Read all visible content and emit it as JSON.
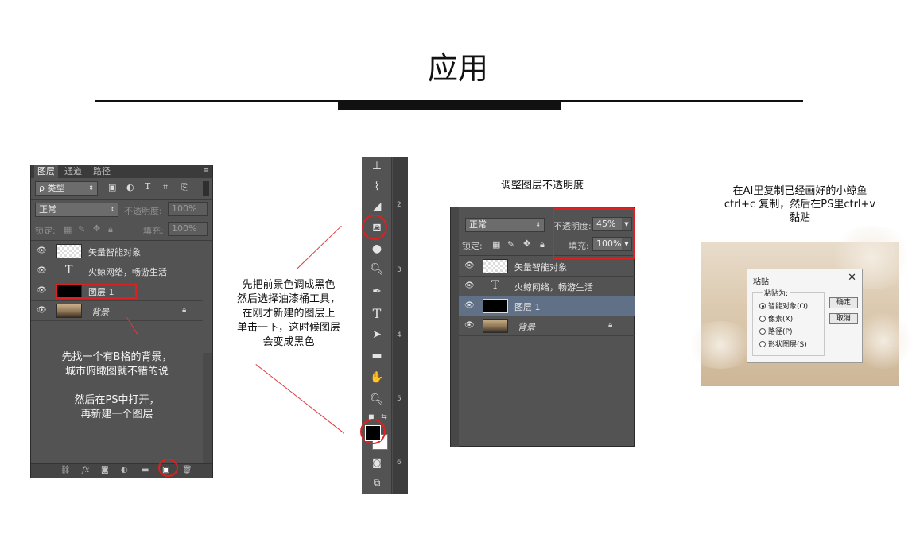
{
  "heading": {
    "title": "应用"
  },
  "left_panel": {
    "tabs": [
      "图层",
      "通道",
      "路径"
    ],
    "menu_icon": "≡",
    "filter_label": "ρ 类型",
    "filter_icons": [
      "image-filter-icon",
      "adjustment-filter-icon",
      "type-filter-icon",
      "shape-filter-icon",
      "smart-object-filter-icon"
    ],
    "blend_mode": "正常",
    "opacity_label": "不透明度:",
    "opacity_value": "100%",
    "lock_label": "锁定:",
    "fill_label": "填充:",
    "fill_value": "100%",
    "layers": [
      {
        "name": "矢量智能对象",
        "type": "smart-object"
      },
      {
        "name": "火鲸网络，畅游生活",
        "type": "text",
        "glyph": "T"
      },
      {
        "name": "图层 1",
        "type": "black-fill"
      },
      {
        "name": "背景",
        "type": "background"
      }
    ],
    "note_lines": [
      "先找一个有B格的背景，",
      "城市俯瞰图就不错的说",
      "",
      "然后在PS中打开，",
      "再新建一个图层"
    ]
  },
  "middle_note_lines": [
    "先把前景色调成黑色",
    "然后选择油漆桶工具，",
    "在刚才新建的图层上",
    "单击一下，这时候图层",
    "会变成黑色"
  ],
  "toolbar": {
    "ruler_numbers": [
      "2",
      "3",
      "4",
      "5",
      "6"
    ],
    "tools": [
      "stamp-icon",
      "history-brush-icon",
      "eraser-icon",
      "paint-bucket-icon",
      "blur-icon",
      "dodge-icon",
      "pen-icon",
      "type-icon",
      "path-select-icon",
      "rectangle-icon",
      "hand-icon",
      "zoom-icon"
    ],
    "type_glyph": "T",
    "foreground_color": "#000000",
    "background_color": "#ffffff"
  },
  "right_panel": {
    "caption": "调整图层不透明度",
    "blend_mode": "正常",
    "opacity_label": "不透明度:",
    "opacity_value": "45%",
    "lock_label": "锁定:",
    "fill_label": "填充:",
    "fill_value": "100%",
    "layers": [
      {
        "name": "矢量智能对象"
      },
      {
        "name": "火鲸网络，畅游生活",
        "glyph": "T"
      },
      {
        "name": "图层 1",
        "selected": true
      },
      {
        "name": "背景"
      }
    ]
  },
  "paste": {
    "caption_lines": [
      "在AI里复制已经画好的小鲸鱼",
      "ctrl+c 复制，然后在PS里ctrl+v",
      "黏贴"
    ],
    "dialog": {
      "title": "粘贴",
      "close": "✕",
      "group_label": "粘贴为:",
      "options": [
        "智能对象(O)",
        "像素(X)",
        "路径(P)",
        "形状图层(S)"
      ],
      "selected_index": 0,
      "ok_label": "确定",
      "cancel_label": "取消"
    }
  },
  "colors": {
    "accent_red": "#e02020",
    "ps_panel": "#535353",
    "selected_layer": "#5f7087"
  }
}
